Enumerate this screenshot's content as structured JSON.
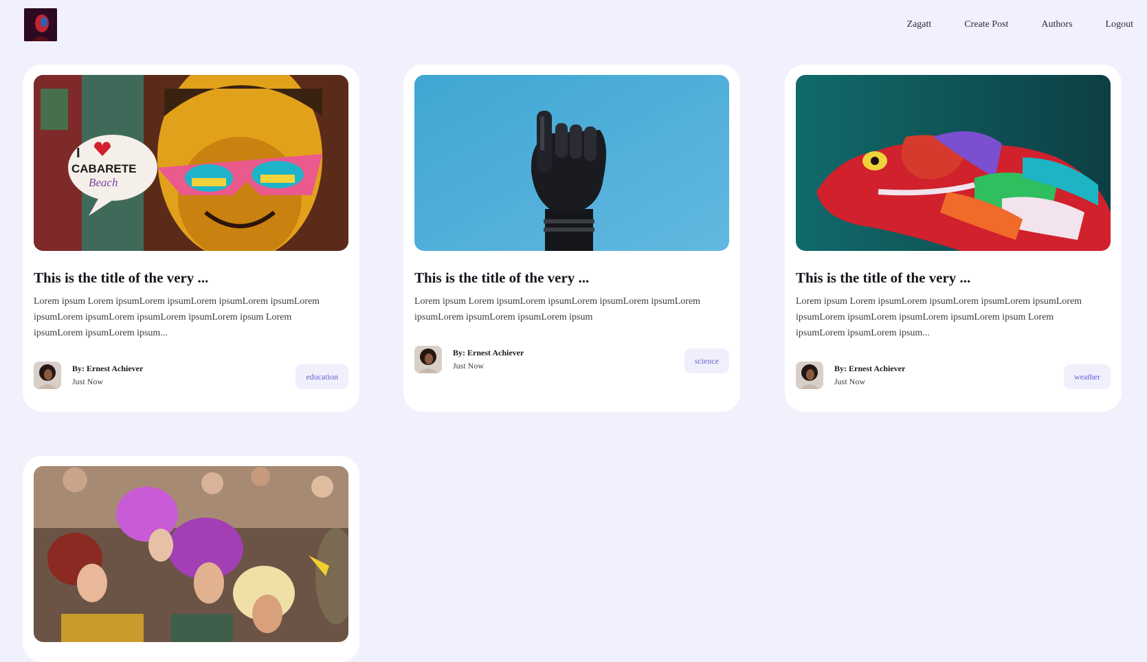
{
  "header": {
    "logo_alt": "Zagatt logo",
    "nav": {
      "home": "Zagatt",
      "create_post": "Create Post",
      "authors": "Authors",
      "logout": "Logout"
    }
  },
  "posts": [
    {
      "title": "This is the title of the very ...",
      "excerpt": "Lorem ipsum Lorem ipsumLorem ipsumLorem ipsumLorem ipsumLorem ipsumLorem ipsumLorem ipsumLorem ipsumLorem ipsum Lorem ipsumLorem ipsumLorem ipsum...",
      "author": "By: Ernest Achiever",
      "date": "Just Now",
      "category": "education",
      "image_icon": "graffiti-photo"
    },
    {
      "title": "This is the title of the very ...",
      "excerpt": "Lorem ipsum Lorem ipsumLorem ipsumLorem ipsumLorem ipsumLorem ipsumLorem ipsumLorem ipsumLorem ipsum",
      "author": "By: Ernest Achiever",
      "date": "Just Now",
      "category": "science",
      "image_icon": "robot-hand-photo"
    },
    {
      "title": "This is the title of the very ...",
      "excerpt": "Lorem ipsum Lorem ipsumLorem ipsumLorem ipsumLorem ipsumLorem ipsumLorem ipsumLorem ipsumLorem ipsumLorem ipsum Lorem ipsumLorem ipsumLorem ipsum...",
      "author": "By: Ernest Achiever",
      "date": "Just Now",
      "category": "weather",
      "image_icon": "chameleon-photo"
    },
    {
      "image_icon": "parade-photo"
    }
  ],
  "colors": {
    "page_bg": "#f1f1fd",
    "card_bg": "#ffffff",
    "tag_bg": "#f0effc",
    "tag_text": "#6a5fd6"
  }
}
